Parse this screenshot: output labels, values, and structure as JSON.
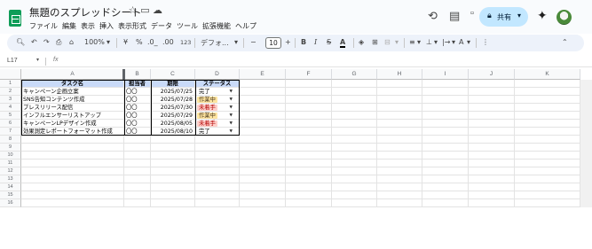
{
  "doc_title": "無題のスプレッドシート",
  "menu": [
    "ファイル",
    "編集",
    "表示",
    "挿入",
    "表示形式",
    "データ",
    "ツール",
    "拡張機能",
    "ヘルプ"
  ],
  "share_label": "共有",
  "toolbar": {
    "zoom": "100%",
    "currency": "¥",
    "percent": "%",
    "dec_decrease": ".0_",
    "dec_increase": ".00",
    "number_format": "123",
    "font_name": "デフォ...",
    "font_size": "10",
    "bold": "B",
    "italic": "I",
    "strike": "S",
    "text_color": "A"
  },
  "name_box": "L17",
  "fx": "fx",
  "columns": [
    "A",
    "B",
    "C",
    "D",
    "E",
    "F",
    "G",
    "H",
    "I",
    "J",
    "K"
  ],
  "rows": [
    "1",
    "2",
    "3",
    "4",
    "5",
    "6",
    "7",
    "8",
    "9",
    "10",
    "11",
    "12",
    "13",
    "14",
    "15",
    "16"
  ],
  "table": {
    "headers": [
      "タスク名",
      "担当者",
      "期限",
      "ステータス"
    ],
    "rows": [
      {
        "task": "キャンペーン企画立案",
        "owner": "〇〇",
        "due": "2025/07/25",
        "status": "完了"
      },
      {
        "task": "SNS告知コンテンツ作成",
        "owner": "〇〇",
        "due": "2025/07/28",
        "status": "作業中"
      },
      {
        "task": "プレスリリース配信",
        "owner": "〇〇",
        "due": "2025/07/30",
        "status": "未着手"
      },
      {
        "task": "インフルエンサーリストアップ",
        "owner": "〇〇",
        "due": "2025/07/29",
        "status": "作業中"
      },
      {
        "task": "キャンペーンLPデザイン作成",
        "owner": "〇〇",
        "due": "2025/08/05",
        "status": "未着手"
      },
      {
        "task": "効果測定レポートフォーマット作成",
        "owner": "〇〇",
        "due": "2025/08/10",
        "status": "完了"
      }
    ]
  },
  "status_colors": {
    "完了": "#ffffff",
    "作業中": "#ffe5a0",
    "未着手": "#ffcfc9"
  },
  "status_text_colors": {
    "完了": "#000000",
    "作業中": "#473822",
    "未着手": "#b10202"
  },
  "colors": {
    "header_fill": "#c9daf8",
    "share_button": "#c2e7ff",
    "logo": "#0f9d58"
  }
}
